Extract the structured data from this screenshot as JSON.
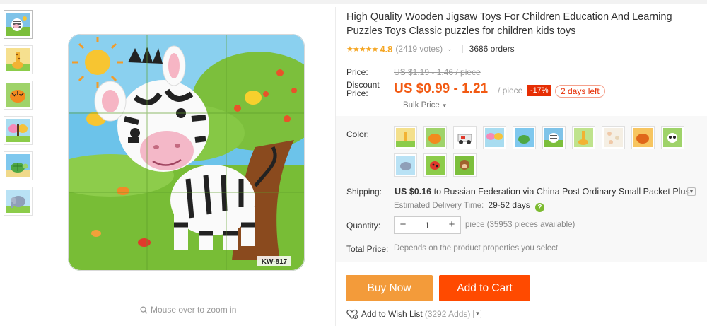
{
  "product": {
    "title": "High Quality Wooden Jigsaw Toys For Children Education And Learning Puzzles Toys Classic puzzles for children kids toys",
    "stars": "★★★★★",
    "rating": "4.8",
    "votes": "(2419 votes)",
    "orders": "3686 orders",
    "image_label": "KW-817",
    "zoom_hint": "Mouse over to zoom in"
  },
  "pricing": {
    "price_label": "Price:",
    "old_price": "US $1.19 - 1.46 / piece",
    "discount_label": "Discount Price:",
    "discount_price": "US $0.99 - 1.21",
    "unit": "/ piece",
    "discount_pct": "-17%",
    "days_left": "2 days left",
    "bulk_price": "Bulk Price"
  },
  "options": {
    "color_label": "Color:",
    "swatch_count": 14
  },
  "shipping": {
    "label": "Shipping:",
    "price": "US $0.16",
    "to": "to",
    "destination": "Russian Federation",
    "via": "via",
    "carrier": "China Post Ordinary Small Packet Plus",
    "delivery_label": "Estimated Delivery Time:",
    "delivery_days": "29-52 days",
    "help": "?"
  },
  "quantity": {
    "label": "Quantity:",
    "minus": "−",
    "value": "1",
    "plus": "+",
    "available": "piece (35953 pieces available)"
  },
  "total": {
    "label": "Total Price:",
    "note": "Depends on the product properties you select"
  },
  "actions": {
    "buy_now": "Buy Now",
    "add_to_cart": "Add to Cart",
    "wishlist": "Add to Wish List",
    "wishlist_count": "(3292 Adds)"
  },
  "colors": {
    "accent": "#f25a13",
    "buy_button": "#f39b3a",
    "cart_button": "#ff4a00",
    "discount_badge": "#e62e04",
    "star": "#f5a623"
  }
}
